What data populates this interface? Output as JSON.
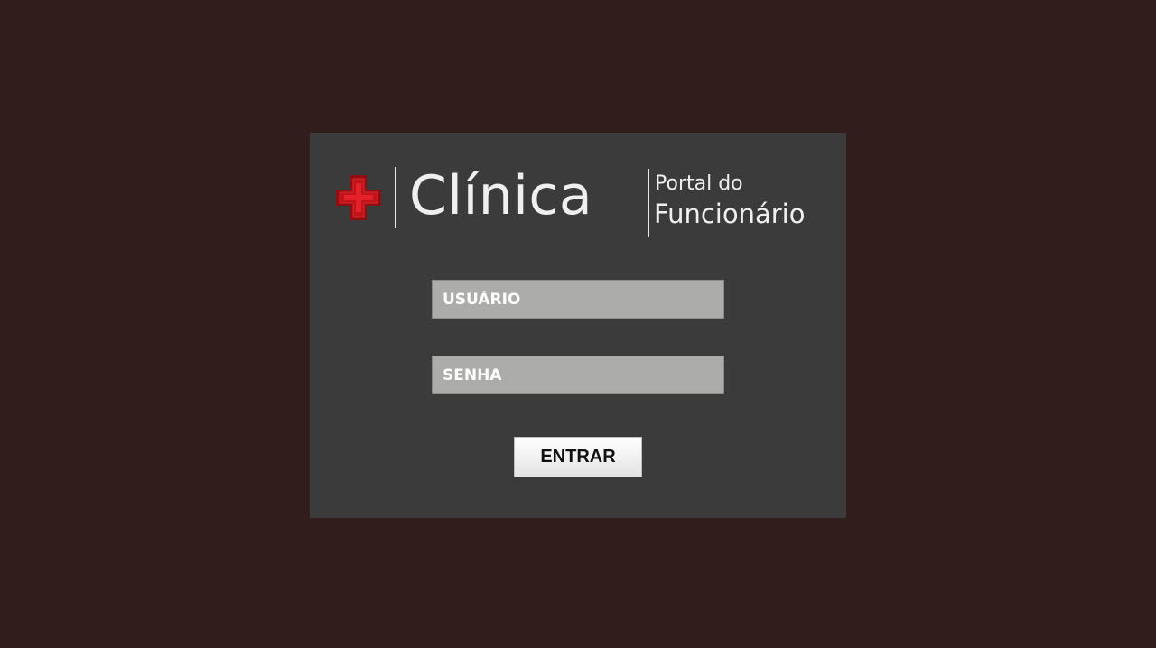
{
  "logo": {
    "icon": "medical-cross-icon",
    "brand": "Clínica",
    "portal_line1": "Portal do",
    "portal_line2": "Funcionário"
  },
  "form": {
    "username_placeholder": "USUÁRIO",
    "username_value": "",
    "password_placeholder": "SENHA",
    "password_value": "",
    "submit_label": "ENTRAR"
  },
  "colors": {
    "page_background": "#321d1d",
    "panel_background": "#3b3b3b",
    "field_background": "#acacab",
    "cross_red": "#c0141a",
    "logo_text": "#efefef"
  }
}
